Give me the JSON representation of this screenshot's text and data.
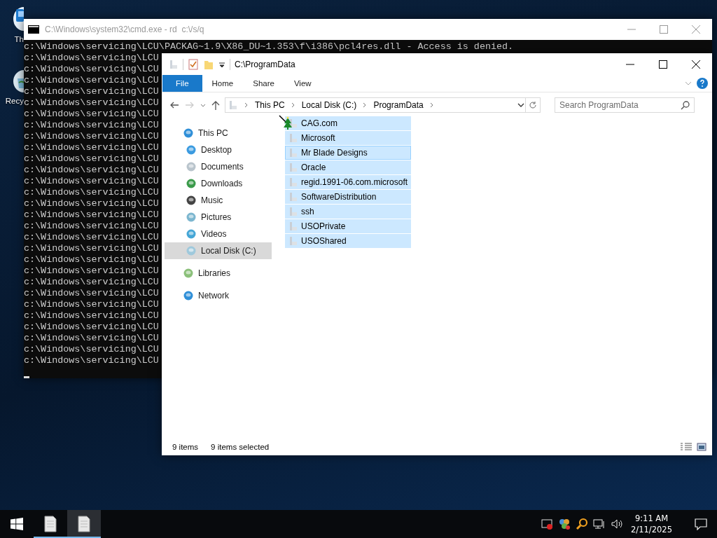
{
  "desktop": {
    "icons": [
      {
        "label": "Th"
      },
      {
        "label": "Recy"
      }
    ]
  },
  "console": {
    "title": "C:\\Windows\\system32\\cmd.exe - rd  c:\\/s/q",
    "lines": [
      "c:\\Windows\\servicing\\LCU\\PACKAG~1.9\\X86_DU~1.353\\f\\i386\\pcl4res.dll - Access is denied.",
      "c:\\Windows\\servicing\\LCU",
      "c:\\Windows\\servicing\\LCU",
      "c:\\Windows\\servicing\\LCU",
      "c:\\Windows\\servicing\\LCU",
      "c:\\Windows\\servicing\\LCU",
      "c:\\Windows\\servicing\\LCU",
      "c:\\Windows\\servicing\\LCU",
      "c:\\Windows\\servicing\\LCU",
      "c:\\Windows\\servicing\\LCU",
      "c:\\Windows\\servicing\\LCU",
      "c:\\Windows\\servicing\\LCU",
      "c:\\Windows\\servicing\\LCU",
      "c:\\Windows\\servicing\\LCU",
      "c:\\Windows\\servicing\\LCU",
      "c:\\Windows\\servicing\\LCU",
      "c:\\Windows\\servicing\\LCU",
      "c:\\Windows\\servicing\\LCU",
      "c:\\Windows\\servicing\\LCU",
      "c:\\Windows\\servicing\\LCU",
      "c:\\Windows\\servicing\\LCU",
      "c:\\Windows\\servicing\\LCU",
      "c:\\Windows\\servicing\\LCU",
      "c:\\Windows\\servicing\\LCU",
      "c:\\Windows\\servicing\\LCU",
      "c:\\Windows\\servicing\\LCU",
      "c:\\Windows\\servicing\\LCU",
      "c:\\Windows\\servicing\\LCU",
      "c:\\Windows\\servicing\\LCU"
    ]
  },
  "explorer": {
    "title": "C:\\ProgramData",
    "ribbon_tabs": [
      {
        "label": "File",
        "kind": "file"
      },
      {
        "label": "Home",
        "kind": "tab"
      },
      {
        "label": "Share",
        "kind": "tab"
      },
      {
        "label": "View",
        "kind": "tab"
      }
    ],
    "breadcrumb": [
      "This PC",
      "Local Disk (C:)",
      "ProgramData"
    ],
    "search": {
      "placeholder": "Search ProgramData"
    },
    "nav": [
      {
        "label": "This PC",
        "kind": "pc",
        "selected": false,
        "children": [
          {
            "label": "Desktop",
            "kind": "desktop",
            "selected": false
          },
          {
            "label": "Documents",
            "kind": "documents",
            "selected": false
          },
          {
            "label": "Downloads",
            "kind": "downloads",
            "selected": false
          },
          {
            "label": "Music",
            "kind": "music",
            "selected": false
          },
          {
            "label": "Pictures",
            "kind": "pictures",
            "selected": false
          },
          {
            "label": "Videos",
            "kind": "videos",
            "selected": false
          },
          {
            "label": "Local Disk (C:)",
            "kind": "disk",
            "selected": true
          }
        ]
      },
      {
        "label": "Libraries",
        "kind": "libraries",
        "selected": false
      },
      {
        "label": "Network",
        "kind": "network",
        "selected": false
      }
    ],
    "files": [
      {
        "name": "CAG.com",
        "selected": true,
        "focused": false
      },
      {
        "name": "Microsoft",
        "selected": true,
        "focused": false
      },
      {
        "name": "Mr Blade Designs",
        "selected": true,
        "focused": true
      },
      {
        "name": "Oracle",
        "selected": true,
        "focused": false
      },
      {
        "name": "regid.1991-06.com.microsoft",
        "selected": true,
        "focused": false
      },
      {
        "name": "SoftwareDistribution",
        "selected": true,
        "focused": false
      },
      {
        "name": "ssh",
        "selected": true,
        "focused": false
      },
      {
        "name": "USOPrivate",
        "selected": true,
        "focused": false
      },
      {
        "name": "USOShared",
        "selected": true,
        "focused": false
      }
    ],
    "status": {
      "count": "9 items",
      "selection": "9 items selected"
    }
  },
  "taskbar": {
    "apps": [
      {
        "selected": false
      },
      {
        "selected": true
      }
    ],
    "time": "9:11 AM",
    "date": "2/11/2025"
  }
}
